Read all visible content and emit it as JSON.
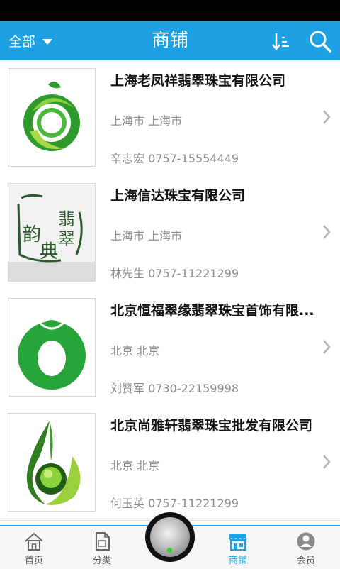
{
  "header": {
    "filter_label": "全部",
    "title": "商铺",
    "bg_color": "#1da1e2"
  },
  "shops": [
    {
      "name": "上海老凤祥翡翠珠宝有限公司",
      "location": "上海市 上海市",
      "contact": "辛志宏 0757-15554449",
      "logo": "green-ring-logo"
    },
    {
      "name": "上海信达珠宝有限公司",
      "location": "上海市 上海市",
      "contact": "林先生 0757-11221299",
      "logo": "calligraphy-seal-logo"
    },
    {
      "name": "北京恒福翠缘翡翠珠宝首饰有限...",
      "location": "北京 北京",
      "contact": "刘赞军 0730-22159998",
      "logo": "green-pendant-logo"
    },
    {
      "name": "北京尚雅轩翡翠珠宝批发有限公司",
      "location": "北京 北京",
      "contact": "何玉英 0757-11221299",
      "logo": "green-drop-logo"
    }
  ],
  "calligraphy_text": "翡翠 韵 典",
  "tabs": [
    {
      "label": "首页",
      "icon": "home-icon"
    },
    {
      "label": "分类",
      "icon": "document-icon"
    },
    {
      "label": "商铺",
      "icon": "store-icon",
      "active": true
    },
    {
      "label": "会员",
      "icon": "user-icon"
    }
  ]
}
